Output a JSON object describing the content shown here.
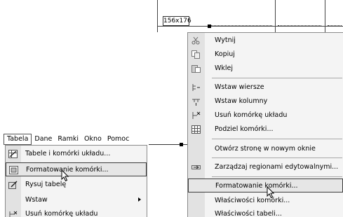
{
  "left_window": {
    "menubar": [
      {
        "label": "Tabela",
        "active": true
      },
      {
        "label": "Dane",
        "active": false
      },
      {
        "label": "Ramki",
        "active": false
      },
      {
        "label": "Okno",
        "active": false
      },
      {
        "label": "Pomoc",
        "active": false
      }
    ],
    "menu_items": [
      {
        "label": "Tabele i komórki układu...",
        "icon": "table-layout-icon",
        "submenu": false,
        "selected": false
      },
      {
        "label": "Formatowanie komórki...",
        "icon": "format-cell-icon",
        "submenu": false,
        "selected": true
      },
      {
        "label": "Rysuj tabelę",
        "icon": "draw-table-icon",
        "submenu": false,
        "selected": false
      },
      {
        "label": "Wstaw",
        "icon": "",
        "submenu": true,
        "selected": false
      },
      {
        "label": "Usuń komórkę układu",
        "icon": "delete-layout-cell-icon",
        "submenu": false,
        "selected": false
      }
    ]
  },
  "design_area": {
    "size_label": "156x176"
  },
  "context_menu": {
    "items": [
      {
        "label": "Wytnij",
        "icon": "scissors-icon",
        "selected": false
      },
      {
        "label": "Kopiuj",
        "icon": "copy-icon",
        "selected": false
      },
      {
        "label": "Wklej",
        "icon": "paste-icon",
        "selected": false
      },
      {
        "label": "Wstaw wiersze",
        "icon": "insert-rows-icon",
        "selected": false
      },
      {
        "label": "Wstaw kolumny",
        "icon": "insert-columns-icon",
        "selected": false
      },
      {
        "label": "Usuń komórkę układu",
        "icon": "delete-layout-cell-icon",
        "selected": false
      },
      {
        "label": "Podziel komórki...",
        "icon": "split-cells-icon",
        "selected": false
      },
      {
        "label": "Otwórz stronę w nowym oknie",
        "icon": "",
        "selected": false
      },
      {
        "label": "Zarządzaj regionami edytowalnymi...",
        "icon": "editable-regions-icon",
        "selected": false
      },
      {
        "label": "Formatowanie komórki...",
        "icon": "",
        "selected": true
      },
      {
        "label": "Właściwości komórki...",
        "icon": "",
        "selected": false
      },
      {
        "label": "Właściwości tabeli...",
        "icon": "",
        "selected": false
      }
    ]
  }
}
